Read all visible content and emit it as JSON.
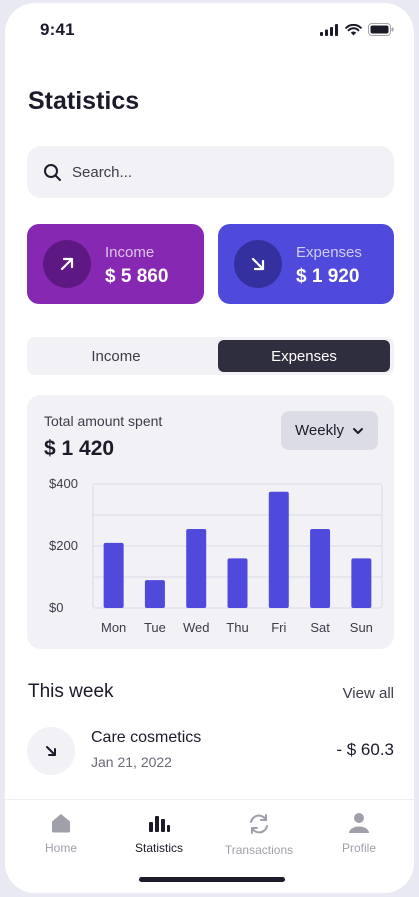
{
  "status_bar": {
    "time": "9:41"
  },
  "page_title": "Statistics",
  "search": {
    "placeholder": "Search..."
  },
  "cards": {
    "income": {
      "label": "Income",
      "amount": "$ 5 860"
    },
    "expenses": {
      "label": "Expenses",
      "amount": "$ 1 920"
    }
  },
  "toggle": {
    "income": "Income",
    "expenses": "Expenses",
    "selected": "Expenses"
  },
  "chart_card": {
    "title": "Total amount spent",
    "total": "$ 1 420",
    "period": "Weekly"
  },
  "chart_data": {
    "type": "bar",
    "categories": [
      "Mon",
      "Tue",
      "Wed",
      "Thu",
      "Fri",
      "Sat",
      "Sun"
    ],
    "values": [
      210,
      90,
      255,
      160,
      375,
      255,
      160
    ],
    "y_ticks": [
      "$400",
      "$200",
      "$0"
    ],
    "ylim": [
      0,
      400
    ],
    "grid": true,
    "color": "#4f4adb"
  },
  "this_week": {
    "title": "This week",
    "view_all": "View all"
  },
  "transactions": [
    {
      "name": "Care cosmetics",
      "date": "Jan 21, 2022",
      "amount": "- $ 60.3"
    }
  ],
  "tabbar": {
    "home": "Home",
    "statistics": "Statistics",
    "transactions": "Transactions",
    "profile": "Profile",
    "active": "Statistics"
  },
  "colors": {
    "income_card": "#8728b3",
    "expenses_card": "#4f4adb",
    "dark": "#2e2e3e",
    "surface": "#f1f1f6"
  }
}
